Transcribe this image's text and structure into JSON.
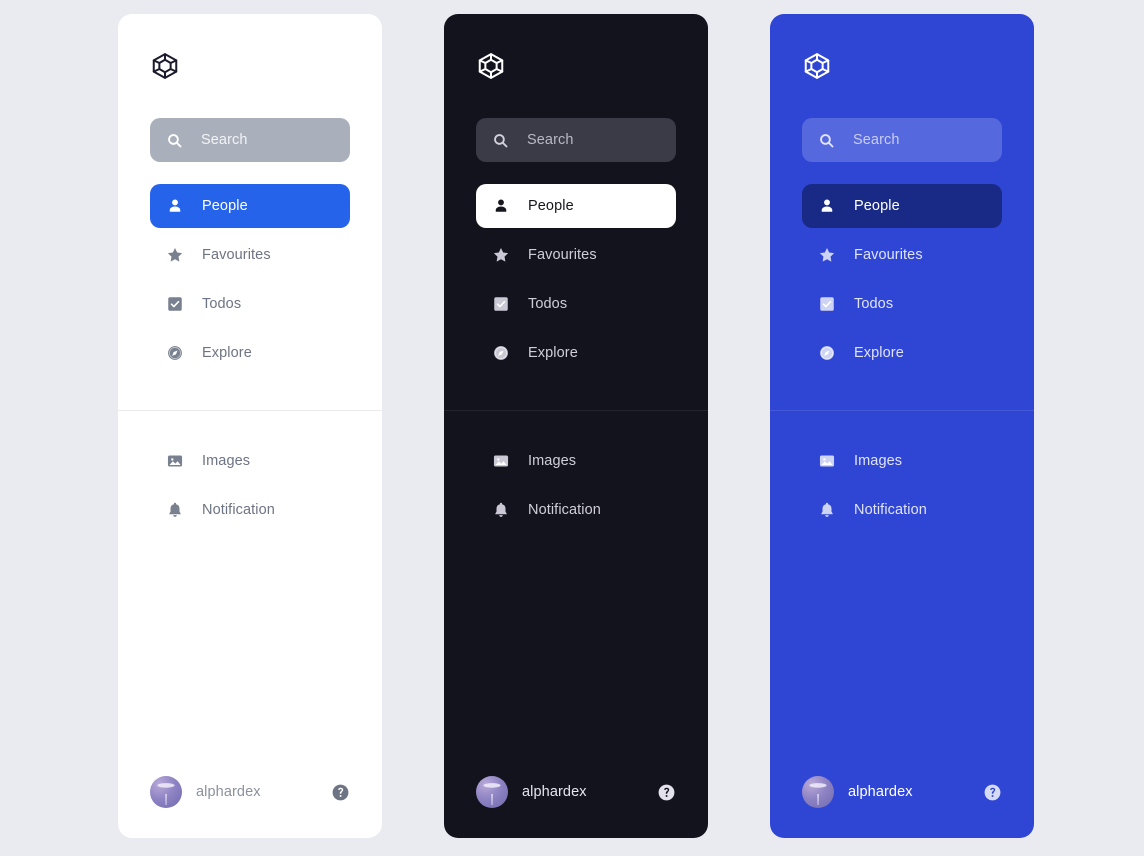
{
  "background_color": "#eaebf0",
  "panels": [
    {
      "theme": "light",
      "panel_bg": "#ffffff",
      "accent": "#2563eb",
      "search": {
        "placeholder": "Search",
        "icon": "search-icon"
      },
      "logo": {
        "icon": "codesandbox-logo-icon"
      },
      "nav_top": [
        {
          "label": "People",
          "icon": "person-icon",
          "active": true
        },
        {
          "label": "Favourites",
          "icon": "star-icon",
          "active": false
        },
        {
          "label": "Todos",
          "icon": "checkbox-checked-icon",
          "active": false
        },
        {
          "label": "Explore",
          "icon": "compass-icon",
          "active": false
        }
      ],
      "nav_bottom": [
        {
          "label": "Images",
          "icon": "image-icon",
          "active": false
        },
        {
          "label": "Notification",
          "icon": "bell-icon",
          "active": false
        }
      ],
      "footer": {
        "user": "alphardex",
        "avatar": "user-avatar",
        "help": "help-circle-icon"
      }
    },
    {
      "theme": "dark",
      "panel_bg": "#13131d",
      "accent": "#ffffff",
      "search": {
        "placeholder": "Search",
        "icon": "search-icon"
      },
      "logo": {
        "icon": "codesandbox-logo-icon"
      },
      "nav_top": [
        {
          "label": "People",
          "icon": "person-icon",
          "active": true
        },
        {
          "label": "Favourites",
          "icon": "star-icon",
          "active": false
        },
        {
          "label": "Todos",
          "icon": "checkbox-checked-icon",
          "active": false
        },
        {
          "label": "Explore",
          "icon": "compass-icon",
          "active": false
        }
      ],
      "nav_bottom": [
        {
          "label": "Images",
          "icon": "image-icon",
          "active": false
        },
        {
          "label": "Notification",
          "icon": "bell-icon",
          "active": false
        }
      ],
      "footer": {
        "user": "alphardex",
        "avatar": "user-avatar",
        "help": "help-circle-icon"
      }
    },
    {
      "theme": "blue",
      "panel_bg": "#2f45d4",
      "accent": "#192a86",
      "search": {
        "placeholder": "Search",
        "icon": "search-icon"
      },
      "logo": {
        "icon": "codesandbox-logo-icon"
      },
      "nav_top": [
        {
          "label": "People",
          "icon": "person-icon",
          "active": true
        },
        {
          "label": "Favourites",
          "icon": "star-icon",
          "active": false
        },
        {
          "label": "Todos",
          "icon": "checkbox-checked-icon",
          "active": false
        },
        {
          "label": "Explore",
          "icon": "compass-icon",
          "active": false
        }
      ],
      "nav_bottom": [
        {
          "label": "Images",
          "icon": "image-icon",
          "active": false
        },
        {
          "label": "Notification",
          "icon": "bell-icon",
          "active": false
        }
      ],
      "footer": {
        "user": "alphardex",
        "avatar": "user-avatar",
        "help": "help-circle-icon"
      }
    }
  ]
}
